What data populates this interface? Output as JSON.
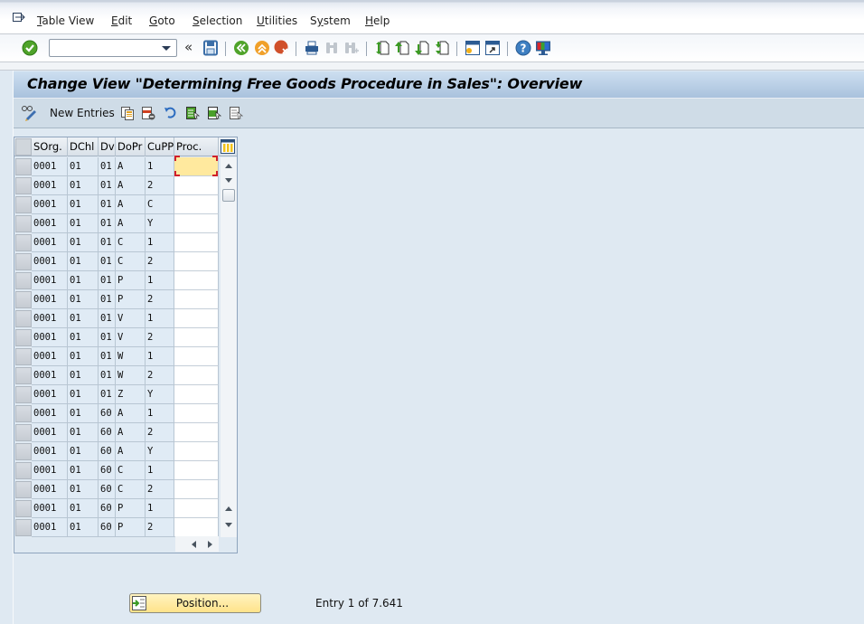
{
  "menubar": {
    "items": [
      {
        "label": "Table View",
        "mnemonic": "T"
      },
      {
        "label": "Edit",
        "mnemonic": "E"
      },
      {
        "label": "Goto",
        "mnemonic": "G"
      },
      {
        "label": "Selection",
        "mnemonic": "S"
      },
      {
        "label": "Utilities",
        "mnemonic": "U"
      },
      {
        "label": "System",
        "mnemonic": "y"
      },
      {
        "label": "Help",
        "mnemonic": "H"
      }
    ]
  },
  "toolbar": {
    "command_field_value": "",
    "collapse_symbol": "«",
    "icons": [
      "enter-icon",
      "save-icon",
      "back-icon",
      "exit-icon",
      "cancel-icon",
      "print-icon",
      "find-icon",
      "find-next-icon",
      "first-page-icon",
      "previous-page-icon",
      "next-page-icon",
      "last-page-icon",
      "create-session-icon",
      "shortcut-icon",
      "help-icon",
      "customize-layout-icon"
    ]
  },
  "title": "Change View \"Determining Free Goods Procedure in Sales\": Overview",
  "app_toolbar": {
    "new_entries_label": "New Entries",
    "icons": [
      "display-change-icon",
      "copy-as-icon",
      "delete-icon",
      "undo-change-icon",
      "select-all-icon",
      "select-block-icon",
      "deselect-all-icon"
    ]
  },
  "table": {
    "columns": [
      "SOrg.",
      "DChl",
      "Dv",
      "DoPr",
      "CuPP",
      "Proc."
    ],
    "rows": [
      [
        "0001",
        "01",
        "01",
        "A",
        "1",
        ""
      ],
      [
        "0001",
        "01",
        "01",
        "A",
        "2",
        ""
      ],
      [
        "0001",
        "01",
        "01",
        "A",
        "C",
        ""
      ],
      [
        "0001",
        "01",
        "01",
        "A",
        "Y",
        ""
      ],
      [
        "0001",
        "01",
        "01",
        "C",
        "1",
        ""
      ],
      [
        "0001",
        "01",
        "01",
        "C",
        "2",
        ""
      ],
      [
        "0001",
        "01",
        "01",
        "P",
        "1",
        ""
      ],
      [
        "0001",
        "01",
        "01",
        "P",
        "2",
        ""
      ],
      [
        "0001",
        "01",
        "01",
        "V",
        "1",
        ""
      ],
      [
        "0001",
        "01",
        "01",
        "V",
        "2",
        ""
      ],
      [
        "0001",
        "01",
        "01",
        "W",
        "1",
        ""
      ],
      [
        "0001",
        "01",
        "01",
        "W",
        "2",
        ""
      ],
      [
        "0001",
        "01",
        "01",
        "Z",
        "Y",
        ""
      ],
      [
        "0001",
        "01",
        "60",
        "A",
        "1",
        ""
      ],
      [
        "0001",
        "01",
        "60",
        "A",
        "2",
        ""
      ],
      [
        "0001",
        "01",
        "60",
        "A",
        "Y",
        ""
      ],
      [
        "0001",
        "01",
        "60",
        "C",
        "1",
        ""
      ],
      [
        "0001",
        "01",
        "60",
        "C",
        "2",
        ""
      ],
      [
        "0001",
        "01",
        "60",
        "P",
        "1",
        ""
      ],
      [
        "0001",
        "01",
        "60",
        "P",
        "2",
        ""
      ]
    ],
    "focused_cell": {
      "row": 0,
      "column": "Proc."
    }
  },
  "footer": {
    "position_button_label": "Position...",
    "entry_info": "Entry 1 of 7.641"
  },
  "colors": {
    "title_gradient_top": "#cddff0",
    "title_gradient_bottom": "#a9c2dd",
    "focus_cell": "#ffe99e",
    "focus_marker": "#d0202a",
    "position_button": "#ffe38a"
  }
}
